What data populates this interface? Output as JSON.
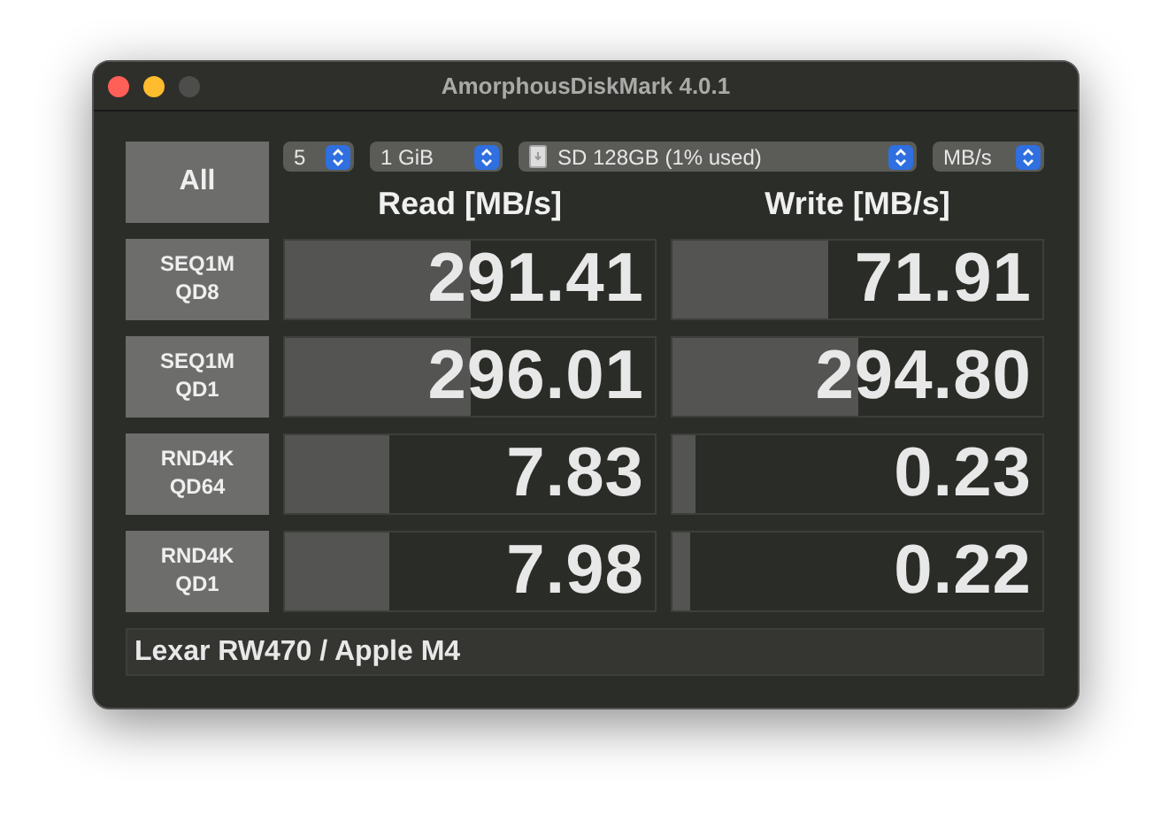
{
  "window": {
    "title": "AmorphousDiskMark 4.0.1"
  },
  "all_button": {
    "label": "All"
  },
  "selects": [
    {
      "kind": "plain",
      "value": "5"
    },
    {
      "kind": "plain",
      "value": "1 GiB"
    },
    {
      "kind": "disk",
      "value": "SD 128GB (1% used)"
    },
    {
      "kind": "plain",
      "value": "MB/s"
    }
  ],
  "columns": [
    "Read [MB/s]",
    "Write [MB/s]"
  ],
  "tests": [
    {
      "label": [
        "SEQ1M",
        "QD8"
      ],
      "read": {
        "value": "291.41",
        "level": 0.5
      },
      "write": {
        "value": "71.91",
        "level": 0.42
      }
    },
    {
      "label": [
        "SEQ1M",
        "QD1"
      ],
      "read": {
        "value": "296.01",
        "level": 0.5
      },
      "write": {
        "value": "294.80",
        "level": 0.5
      }
    },
    {
      "label": [
        "RND4K",
        "QD64"
      ],
      "read": {
        "value": "7.83",
        "level": 0.28
      },
      "write": {
        "value": "0.23",
        "level": 0.06
      }
    },
    {
      "label": [
        "RND4K",
        "QD1"
      ],
      "read": {
        "value": "7.98",
        "level": 0.28
      },
      "write": {
        "value": "0.22",
        "level": 0.05
      }
    }
  ],
  "comment": {
    "value": "Lexar RW470 / Apple M4"
  }
}
